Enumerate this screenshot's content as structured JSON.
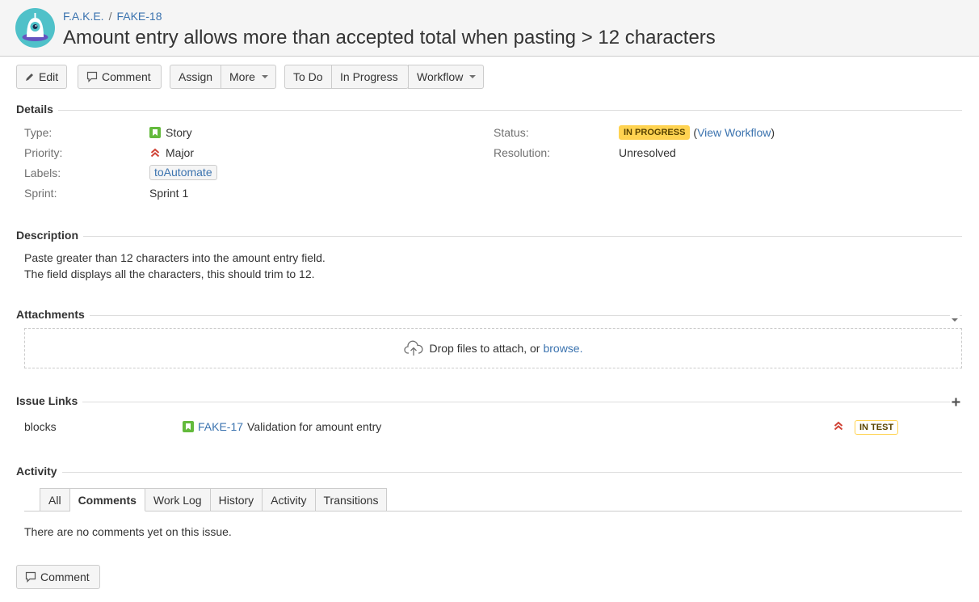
{
  "header": {
    "project": "F.A.K.E.",
    "separator": "/",
    "issue_key": "FAKE-18",
    "title": "Amount entry allows more than accepted total when pasting > 12 characters"
  },
  "toolbar": {
    "edit": "Edit",
    "comment": "Comment",
    "assign": "Assign",
    "more": "More",
    "todo": "To Do",
    "in_progress": "In Progress",
    "workflow": "Workflow"
  },
  "details": {
    "heading": "Details",
    "type_label": "Type:",
    "type_value": "Story",
    "priority_label": "Priority:",
    "priority_value": "Major",
    "labels_label": "Labels:",
    "labels_value": "toAutomate",
    "sprint_label": "Sprint:",
    "sprint_value": "Sprint 1",
    "status_label": "Status:",
    "status_value": "IN PROGRESS",
    "view_workflow_open": "(",
    "view_workflow": "View Workflow",
    "view_workflow_close": ")",
    "resolution_label": "Resolution:",
    "resolution_value": "Unresolved"
  },
  "description": {
    "heading": "Description",
    "line1": "Paste greater than 12 characters into the amount entry field.",
    "line2": "The field displays all the characters, this should trim to 12."
  },
  "attachments": {
    "heading": "Attachments",
    "drop_text": "Drop files to attach, or",
    "browse": "browse."
  },
  "issue_links": {
    "heading": "Issue Links",
    "relation": "blocks",
    "linked_key": "FAKE-17",
    "linked_summary": "Validation for amount entry",
    "linked_status": "IN TEST"
  },
  "activity": {
    "heading": "Activity",
    "tabs": [
      "All",
      "Comments",
      "Work Log",
      "History",
      "Activity",
      "Transitions"
    ],
    "active_tab": "Comments",
    "empty_text": "There are no comments yet on this issue.",
    "comment_button": "Comment"
  },
  "colors": {
    "link": "#3b73af",
    "story_green": "#63ba3c",
    "priority_red": "#d04437",
    "in_progress_bg": "#ffd351",
    "avatar_teal": "#4fc1c9"
  }
}
